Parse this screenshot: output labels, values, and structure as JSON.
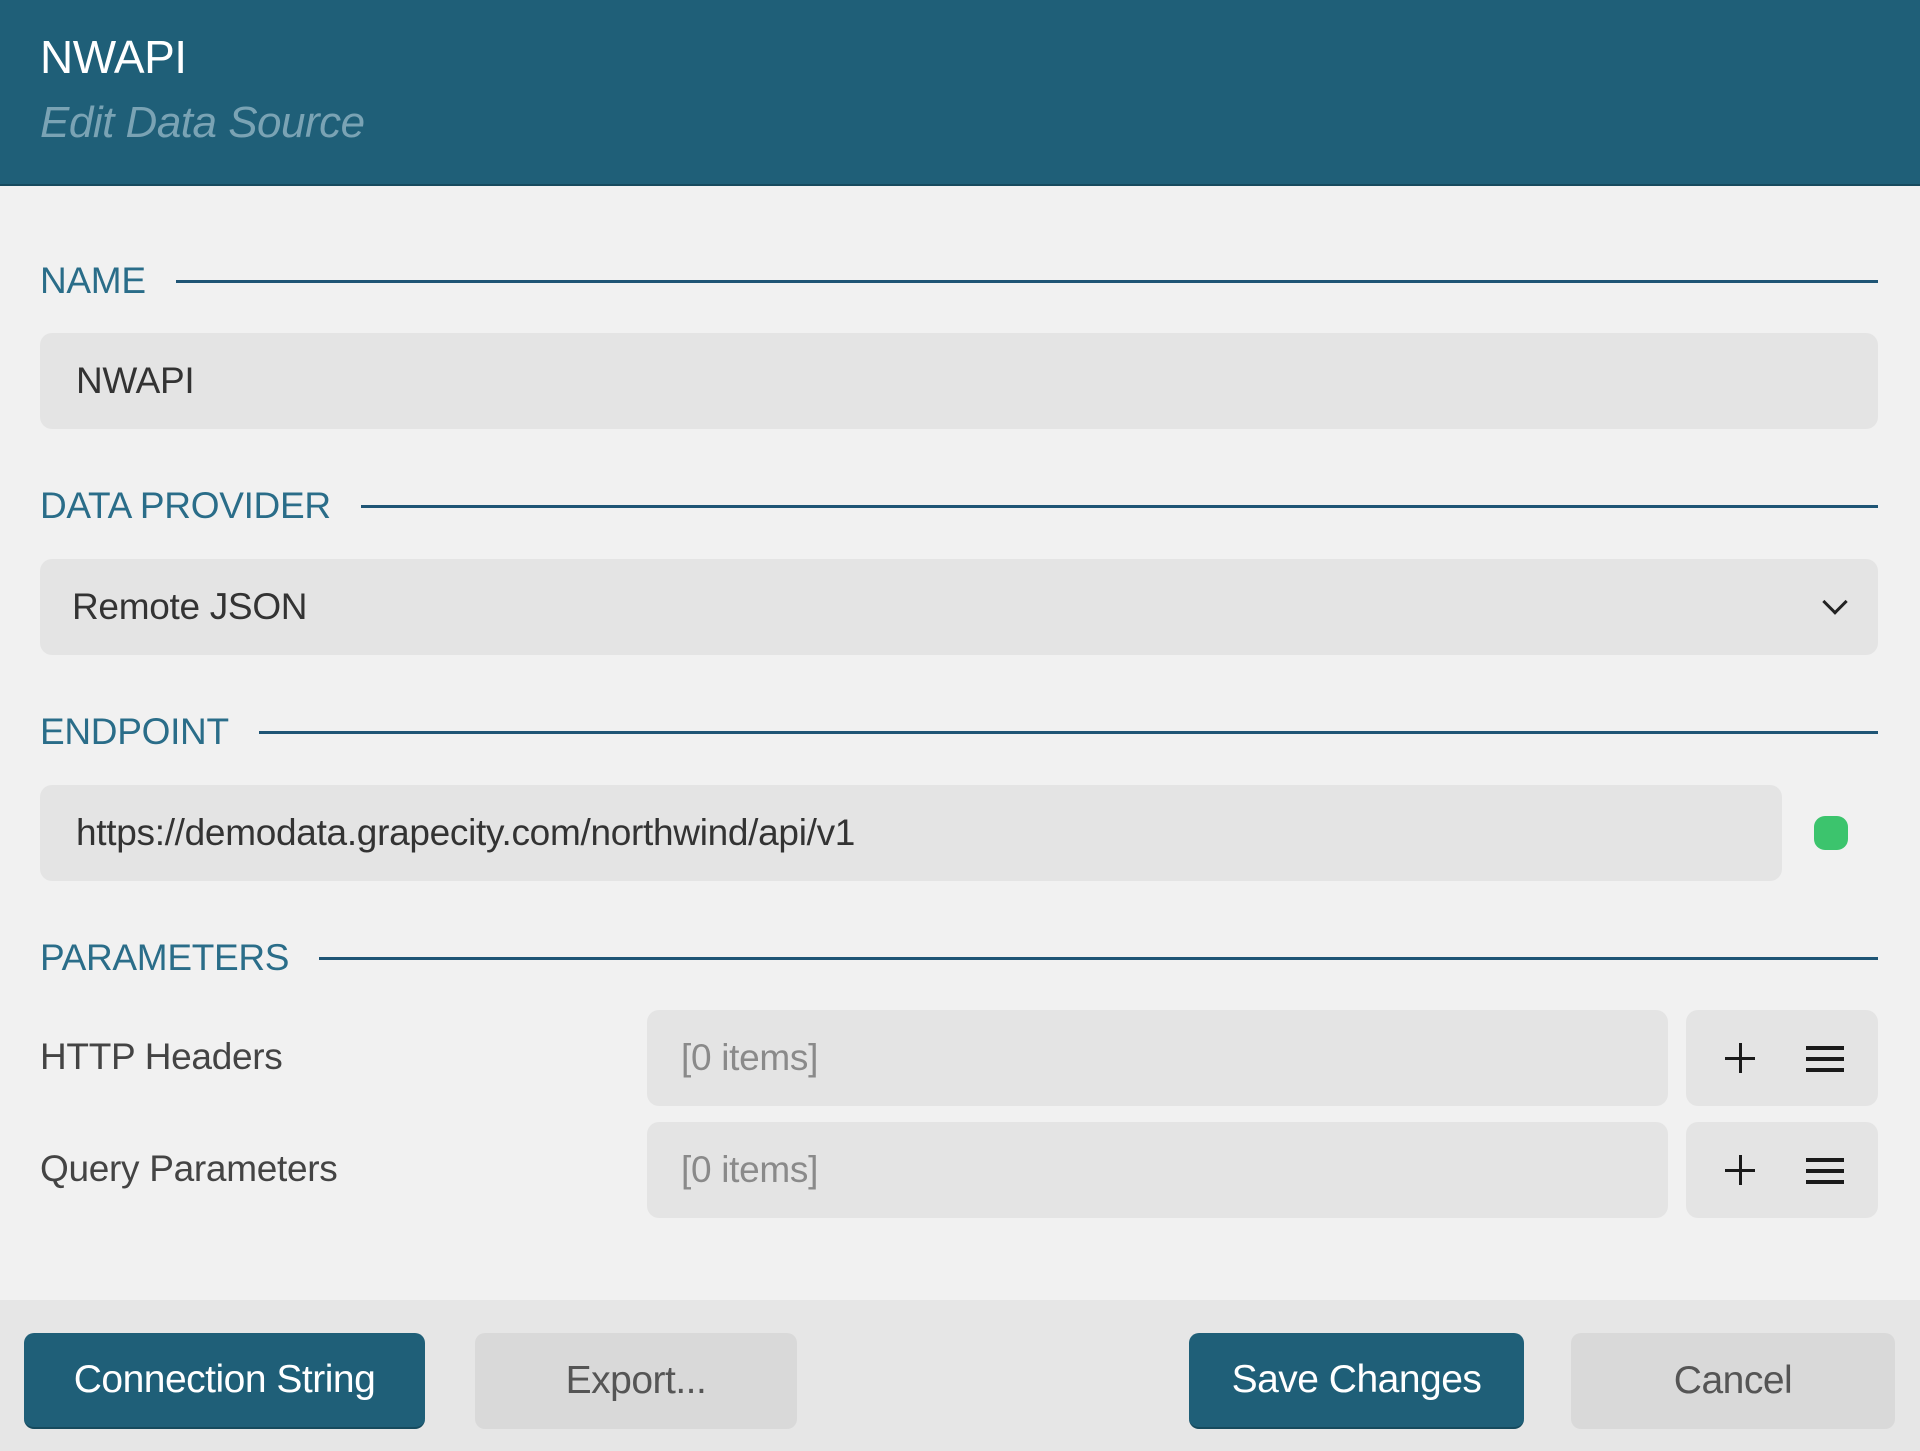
{
  "header": {
    "title": "NWAPI",
    "subtitle": "Edit Data Source"
  },
  "sections": {
    "name": {
      "label": "NAME",
      "value": "NWAPI"
    },
    "data_provider": {
      "label": "DATA PROVIDER",
      "selected": "Remote JSON"
    },
    "endpoint": {
      "label": "ENDPOINT",
      "value": "https://demodata.grapecity.com/northwind/api/v1",
      "status": "connected",
      "status_color": "#3cc46d"
    },
    "parameters": {
      "label": "PARAMETERS",
      "rows": [
        {
          "label": "HTTP Headers",
          "value": "[0 items]"
        },
        {
          "label": "Query Parameters",
          "value": "[0 items]"
        }
      ]
    }
  },
  "footer": {
    "connection_string_label": "Connection String",
    "export_label": "Export...",
    "save_label": "Save Changes",
    "cancel_label": "Cancel"
  },
  "colors": {
    "accent": "#1f5f78",
    "section_label": "#2a6d89",
    "background": "#f1f1f1",
    "field_background": "#e4e4e4"
  }
}
